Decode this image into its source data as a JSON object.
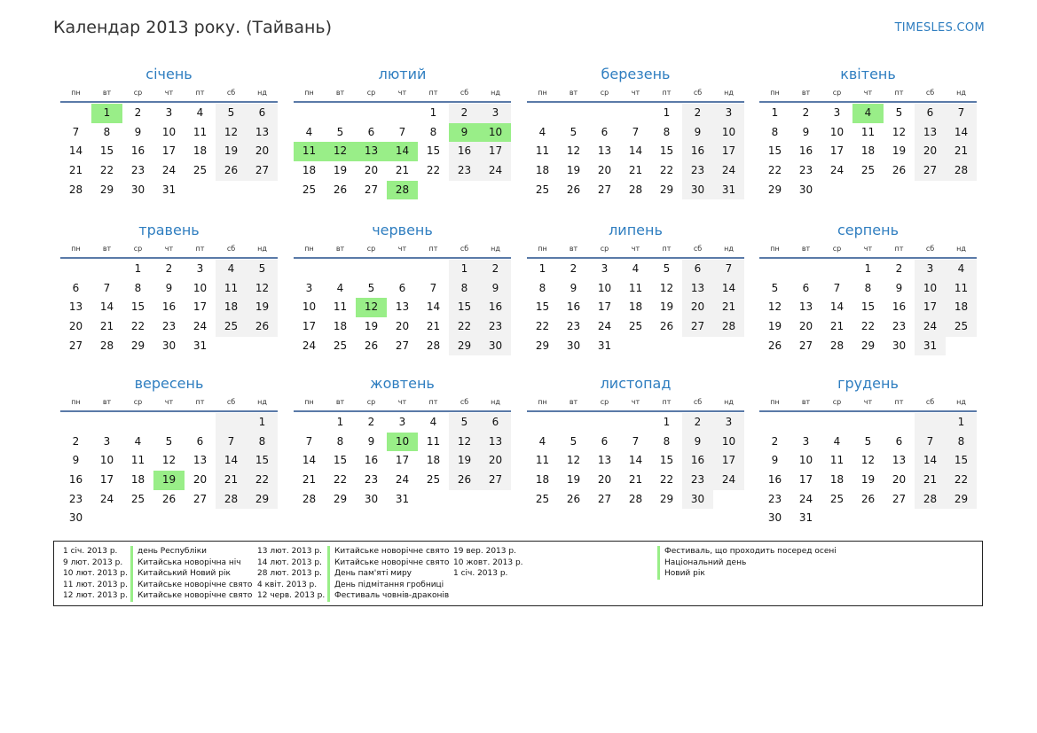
{
  "title": "Календар 2013 року. (Тайвань)",
  "site": "TIMESLES.COM",
  "colors": {
    "accent": "#2f7ec0",
    "holiday": "#99ee88",
    "weekend": "#f2f2f2"
  },
  "weekdays": [
    "пн",
    "вт",
    "ср",
    "чт",
    "пт",
    "сб",
    "нд"
  ],
  "months": [
    {
      "name": "січень",
      "offset": 1,
      "days": 31,
      "holidays": [
        1
      ]
    },
    {
      "name": "лютий",
      "offset": 4,
      "days": 28,
      "holidays": [
        9,
        10,
        11,
        12,
        13,
        14,
        28
      ]
    },
    {
      "name": "березень",
      "offset": 4,
      "days": 31,
      "holidays": []
    },
    {
      "name": "квітень",
      "offset": 0,
      "days": 30,
      "holidays": [
        4
      ]
    },
    {
      "name": "травень",
      "offset": 2,
      "days": 31,
      "holidays": []
    },
    {
      "name": "червень",
      "offset": 5,
      "days": 30,
      "holidays": [
        12
      ]
    },
    {
      "name": "липень",
      "offset": 0,
      "days": 31,
      "holidays": []
    },
    {
      "name": "серпень",
      "offset": 3,
      "days": 31,
      "holidays": []
    },
    {
      "name": "вересень",
      "offset": 6,
      "days": 30,
      "holidays": [
        19
      ]
    },
    {
      "name": "жовтень",
      "offset": 1,
      "days": 31,
      "holidays": [
        10
      ]
    },
    {
      "name": "листопад",
      "offset": 4,
      "days": 30,
      "holidays": []
    },
    {
      "name": "грудень",
      "offset": 6,
      "days": 31,
      "holidays": []
    }
  ],
  "legend": {
    "col1": [
      {
        "date": "1 січ. 2013 р.",
        "name": "день Республіки"
      },
      {
        "date": "9 лют. 2013 р.",
        "name": "Китайська новорічна ніч"
      },
      {
        "date": "10 лют. 2013 р.",
        "name": "Китайський Новий рік"
      },
      {
        "date": "11 лют. 2013 р.",
        "name": "Китайське новорічне свято"
      },
      {
        "date": "12 лют. 2013 р.",
        "name": "Китайське новорічне свято"
      }
    ],
    "col2": [
      {
        "date": "13 лют. 2013 р.",
        "name": "Китайське новорічне свято"
      },
      {
        "date": "14 лют. 2013 р.",
        "name": "Китайське новорічне свято"
      },
      {
        "date": "28 лют. 2013 р.",
        "name": "День пам'яті миру"
      },
      {
        "date": "4 квіт. 2013 р.",
        "name": "День підмітання гробниці"
      },
      {
        "date": "12 черв. 2013 р.",
        "name": "Фестиваль човнів-драконів"
      }
    ],
    "col3": [
      {
        "date": "19 вер. 2013 р.",
        "name": "Фестиваль, що проходить посеред осені"
      },
      {
        "date": "10 жовт. 2013 р.",
        "name": "Національний день"
      },
      {
        "date": "1 січ. 2013 р.",
        "name": "Новий рік"
      }
    ]
  }
}
